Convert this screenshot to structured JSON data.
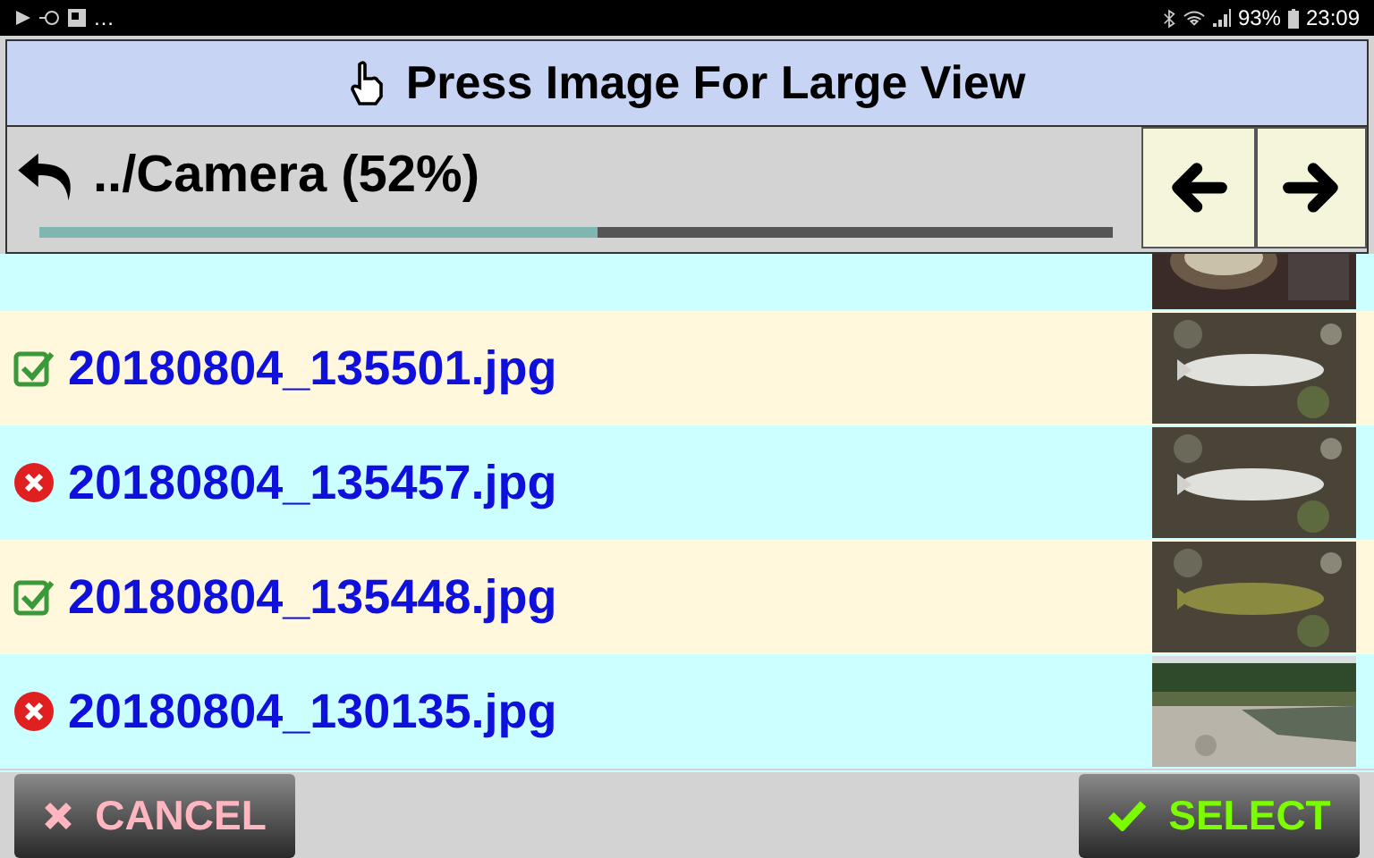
{
  "status_bar": {
    "overflow": "…",
    "battery": "93%",
    "time": "23:09"
  },
  "header": {
    "title": "Press Image For Large View",
    "path": "../Camera (52%)",
    "progress": {
      "level": 0.52
    }
  },
  "files": [
    {
      "name": "20180804_135501.jpg",
      "selected": true
    },
    {
      "name": "20180804_135457.jpg",
      "selected": false
    },
    {
      "name": "20180804_135448.jpg",
      "selected": true
    },
    {
      "name": "20180804_130135.jpg",
      "selected": false
    }
  ],
  "buttons": [
    {
      "label": "CANCEL",
      "kind": "cancel"
    },
    {
      "label": "SELECT",
      "kind": "select"
    }
  ]
}
